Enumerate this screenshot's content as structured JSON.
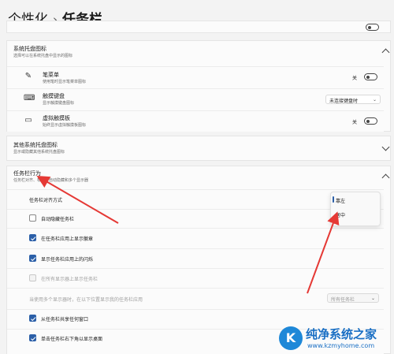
{
  "breadcrumb": {
    "parent": "个性化",
    "separator": "›",
    "current": "任务栏"
  },
  "tray_icons": {
    "title": "系统托盘图标",
    "subtitle": "选择可以在系统托盘中显示的图标",
    "items": [
      {
        "icon": "pen-icon",
        "title": "笔菜单",
        "subtitle": "使用笔时显示笔菜单图标",
        "control": "toggle",
        "value": "关"
      },
      {
        "icon": "keyboard-icon",
        "title": "触摸键盘",
        "subtitle": "显示触摸键盘图标",
        "control": "select",
        "value": "未连接键盘时"
      },
      {
        "icon": "touchpad-icon",
        "title": "虚拟触摸板",
        "subtitle": "始终显示虚拟触摸板图标",
        "control": "toggle",
        "value": "关"
      }
    ]
  },
  "other_tray": {
    "title": "其他系统托盘图标",
    "subtitle": "显示或隐藏其他系统托盘图标"
  },
  "behavior": {
    "title": "任务栏行为",
    "subtitle": "任务栏对齐、标志、自动隐藏和多个显示器",
    "alignment_label": "任务栏对齐方式",
    "alignment_options": [
      "靠左",
      "居中"
    ],
    "alignment_selected": "靠左",
    "checkboxes": [
      {
        "label": "自动隐藏任务栏",
        "state": "off"
      },
      {
        "label": "在任务栏应用上显示徽章",
        "state": "on"
      },
      {
        "label": "显示任务栏应用上的闪烁",
        "state": "on"
      },
      {
        "label": "在所有显示器上显示任务栏",
        "state": "disabled"
      }
    ],
    "multi_display_label": "当使用多个显示器时，在以下位置显示我的任务栏应用",
    "multi_display_value": "所有任务栏",
    "more_checkboxes": [
      {
        "label": "从任务栏共享任何窗口",
        "state": "on"
      },
      {
        "label": "单击任务栏右下角以显示桌面",
        "state": "on"
      }
    ]
  },
  "watermark": {
    "logo": "K",
    "title": "纯净系统之家",
    "url": "www.kzmyhome.com"
  },
  "colors": {
    "accent": "#2b5fa8",
    "annotation": "#e53935"
  }
}
